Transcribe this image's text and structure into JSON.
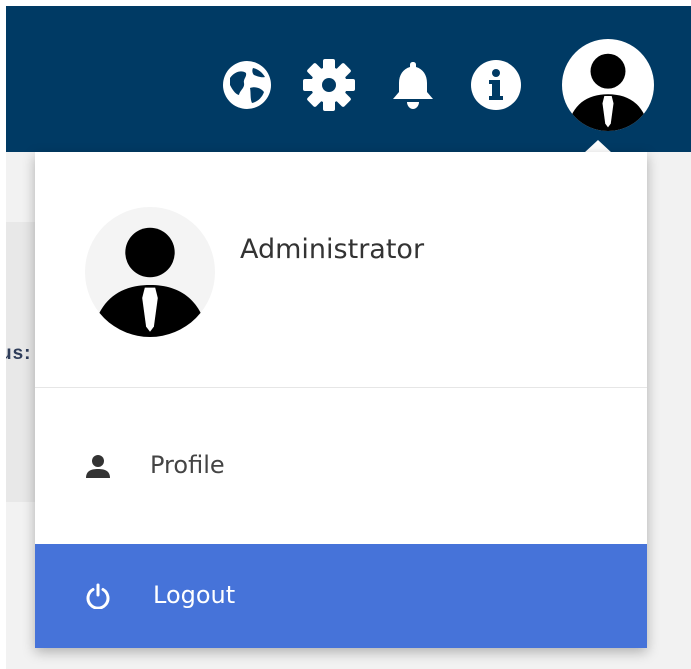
{
  "background": {
    "partial_text": "us:"
  },
  "topbar": {
    "icons": [
      "globe-icon",
      "gear-icon",
      "bell-icon",
      "info-icon"
    ],
    "avatar": "user-avatar-icon"
  },
  "dropdown": {
    "user_name": "Administrator",
    "items": [
      {
        "label": "Profile",
        "icon": "person-icon"
      },
      {
        "label": "Logout",
        "icon": "power-icon"
      }
    ]
  },
  "colors": {
    "topbar": "#003a64",
    "logout_highlight": "#4673d9",
    "text": "#333333"
  }
}
